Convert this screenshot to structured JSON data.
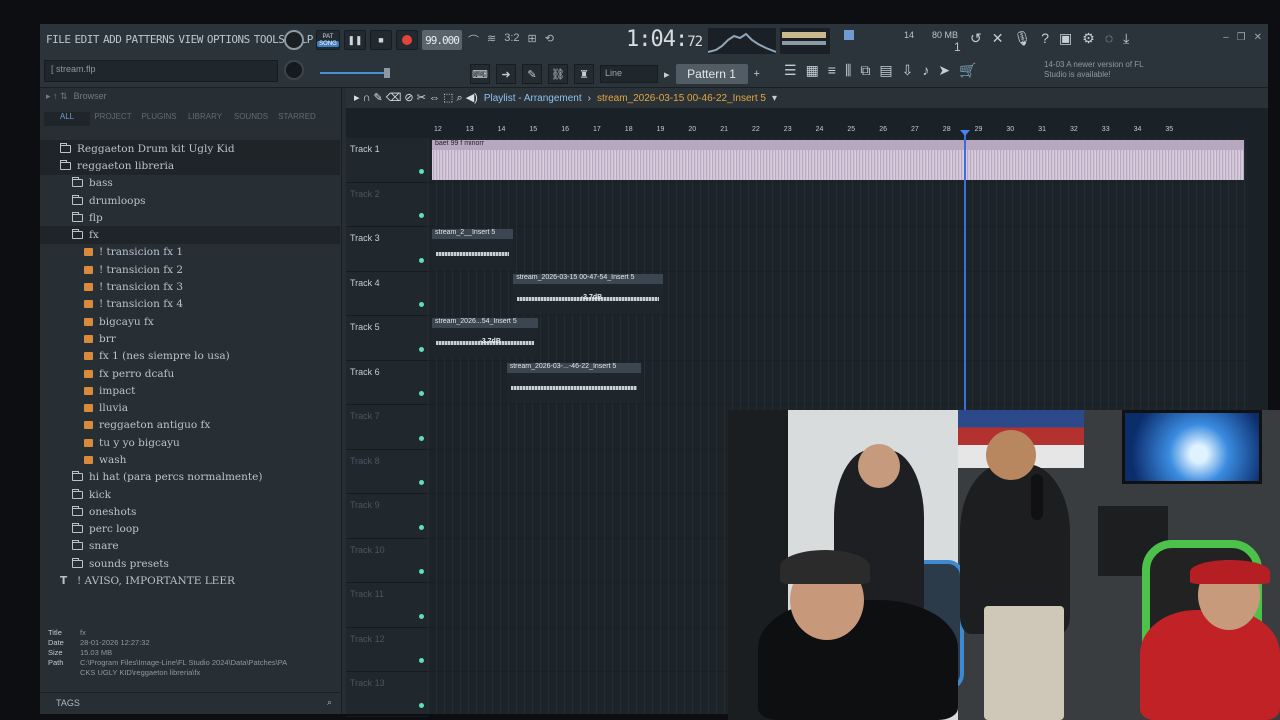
{
  "menu": [
    "FILE",
    "EDIT",
    "ADD",
    "PATTERNS",
    "VIEW",
    "OPTIONS",
    "TOOLS",
    "HELP"
  ],
  "project_file": "stream.flp",
  "transport": {
    "pat_label": "PAT",
    "song_label": "SONG",
    "tempo": "99.000"
  },
  "time": {
    "main": "1:04",
    "sub": "72"
  },
  "cpu": {
    "polyphony": "14",
    "memory": "80 MB",
    "value": "1"
  },
  "toolbar": {
    "snap_value": "Line",
    "pattern": "Pattern 1"
  },
  "news": {
    "date": "14-03",
    "text": "A newer version of FL Studio is available!"
  },
  "browser": {
    "title": "Browser",
    "tabs": [
      "ALL",
      "PROJECT",
      "PLUGINS",
      "LIBRARY",
      "SOUNDS",
      "STARRED"
    ],
    "items": [
      {
        "type": "folder",
        "label": "Reggaeton Drum kit Ugly Kid",
        "indent": 1
      },
      {
        "type": "folder",
        "label": "reggaeton libreria",
        "indent": 1
      },
      {
        "type": "folder",
        "label": "bass",
        "indent": 2
      },
      {
        "type": "folder",
        "label": "drumloops",
        "indent": 2
      },
      {
        "type": "folder",
        "label": "flp",
        "indent": 2
      },
      {
        "type": "folder",
        "label": "fx",
        "indent": 2
      },
      {
        "type": "file",
        "label": "! transicion fx 1",
        "indent": 3
      },
      {
        "type": "file",
        "label": "! transicion fx 2",
        "indent": 3
      },
      {
        "type": "file",
        "label": "! transicion fx 3",
        "indent": 3
      },
      {
        "type": "file",
        "label": "! transicion fx 4",
        "indent": 3
      },
      {
        "type": "file",
        "label": "bigcayu fx",
        "indent": 3
      },
      {
        "type": "file",
        "label": "brr",
        "indent": 3
      },
      {
        "type": "file",
        "label": "fx 1 (nes siempre lo usa)",
        "indent": 3
      },
      {
        "type": "file",
        "label": "fx perro dcafu",
        "indent": 3
      },
      {
        "type": "file",
        "label": "impact",
        "indent": 3
      },
      {
        "type": "file",
        "label": "lluvia",
        "indent": 3
      },
      {
        "type": "file",
        "label": "reggaeton antiguo fx",
        "indent": 3
      },
      {
        "type": "file",
        "label": "tu y yo bigcayu",
        "indent": 3
      },
      {
        "type": "file",
        "label": "wash",
        "indent": 3
      },
      {
        "type": "folder",
        "label": "hi hat (para percs normalmente)",
        "indent": 2
      },
      {
        "type": "folder",
        "label": "kick",
        "indent": 2
      },
      {
        "type": "folder",
        "label": "oneshots",
        "indent": 2
      },
      {
        "type": "folder",
        "label": "perc loop",
        "indent": 2
      },
      {
        "type": "folder",
        "label": "snare",
        "indent": 2
      },
      {
        "type": "folder",
        "label": "sounds presets",
        "indent": 2
      },
      {
        "type": "text",
        "label": "! AVISO, IMPORTANTE LEER",
        "indent": 1
      }
    ],
    "info": {
      "title_key": "Title",
      "title": "fx",
      "date_key": "Date",
      "date": "28-01-2026 12:27:32",
      "size_key": "Size",
      "size": "15.03 MB",
      "path_key": "Path",
      "path": "C:\\Program Files\\Image-Line\\FL Studio 2024\\Data\\Patches\\PACKS UGLY KID\\reggaeton libreria\\fx"
    },
    "tags_label": "TAGS"
  },
  "playlist": {
    "title_prefix": "Playlist - Arrangement",
    "title_arrangement": "stream_2026-03-15 00-46-22_Insert 5",
    "ruler": [
      "12",
      "13",
      "14",
      "15",
      "16",
      "17",
      "18",
      "19",
      "20",
      "21",
      "22",
      "23",
      "24",
      "25",
      "26",
      "27",
      "28",
      "29",
      "30",
      "31",
      "32",
      "33",
      "34",
      "35"
    ],
    "tracks": [
      "Track 1",
      "Track 2",
      "Track 3",
      "Track 4",
      "Track 5",
      "Track 6",
      "Track 7",
      "Track 8",
      "Track 9",
      "Track 10",
      "Track 11",
      "Track 12",
      "Track 13"
    ],
    "clips": [
      {
        "name": "baet 99 f minorr",
        "track": 0,
        "start": 0,
        "len": 1,
        "style": "main",
        "db": ""
      },
      {
        "name": "stream_2__Insert 5",
        "track": 2,
        "start": 0,
        "len": 0.1,
        "style": "sub",
        "db": ""
      },
      {
        "name": "stream_2026-03-15 00-47-54_Insert 5",
        "track": 3,
        "start": 0.1,
        "len": 0.185,
        "style": "sub",
        "db": "-3.7dB"
      },
      {
        "name": "stream_2026...54_Insert 5",
        "track": 4,
        "start": 0,
        "len": 0.13,
        "style": "sub",
        "db": "-3.7dB"
      },
      {
        "name": "stream_2026-03-...-46-22_Insert 5",
        "track": 5,
        "start": 0.092,
        "len": 0.165,
        "style": "sub",
        "db": ""
      }
    ]
  }
}
